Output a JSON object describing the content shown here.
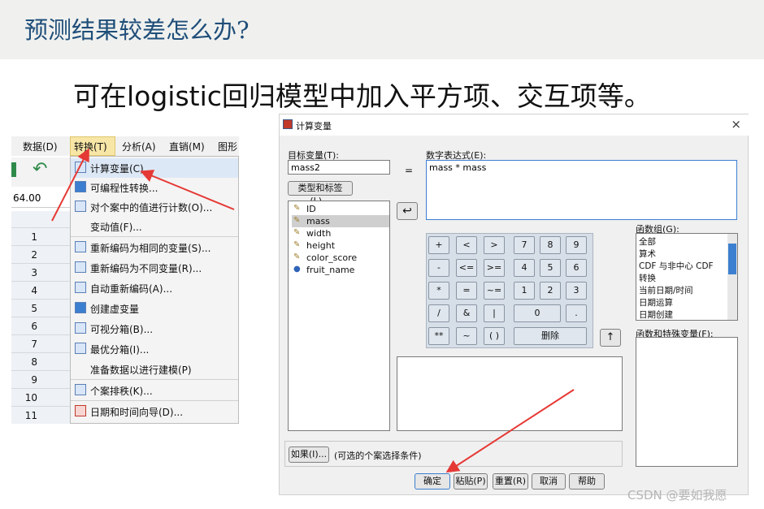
{
  "slide": {
    "title": "预测结果较差怎么办?",
    "subtitle": "可在logistic回归模型中加入平方项、交互项等。",
    "watermark": "CSDN @要如我愿"
  },
  "spss": {
    "menu_top": [
      "数据(D)",
      "转换(T)",
      "分析(A)",
      "直销(M)",
      "图形"
    ],
    "cell_value": "64.00",
    "row_numbers": [
      "1",
      "2",
      "3",
      "4",
      "5",
      "6",
      "7",
      "8",
      "9",
      "10",
      "11"
    ],
    "transform_menu": [
      {
        "label": "计算变量(C)...",
        "icon": "calculator-icon"
      },
      {
        "label": "可编程性转换...",
        "icon": "plus-icon"
      },
      {
        "label": "对个案中的值进行计数(O)...",
        "icon": "count-icon"
      },
      {
        "label": "变动值(F)...",
        "icon": ""
      },
      {
        "label": "重新编码为相同的变量(S)...",
        "icon": "recode-same-icon"
      },
      {
        "label": "重新编码为不同变量(R)...",
        "icon": "recode-different-icon"
      },
      {
        "label": "自动重新编码(A)...",
        "icon": "auto-recode-icon"
      },
      {
        "label": "创建虚变量",
        "icon": "plus-icon"
      },
      {
        "label": "可视分箱(B)...",
        "icon": "binning-icon"
      },
      {
        "label": "最优分箱(I)...",
        "icon": "optimal-binning-icon"
      },
      {
        "label": "准备数据以进行建模(P)",
        "icon": ""
      },
      {
        "label": "个案排秩(K)...",
        "icon": "rank-icon"
      },
      {
        "label": "日期和时间向导(D)...",
        "icon": "calendar-icon"
      }
    ]
  },
  "dialog": {
    "title": "计算变量",
    "target_label": "目标变量(T):",
    "target_value": "mass2",
    "equals": "=",
    "expr_label": "数字表达式(E):",
    "expr_value": "mass * mass",
    "type_label_button": "类型和标签(L)...",
    "variables": [
      {
        "name": "ID",
        "icon": "ruler-icon"
      },
      {
        "name": "mass",
        "icon": "ruler-icon",
        "selected": true
      },
      {
        "name": "width",
        "icon": "ruler-icon"
      },
      {
        "name": "height",
        "icon": "ruler-icon"
      },
      {
        "name": "color_score",
        "icon": "ruler-icon"
      },
      {
        "name": "fruit_name",
        "icon": "nominal-icon"
      }
    ],
    "keypad": {
      "row1": [
        "+",
        "<",
        ">",
        "7",
        "8",
        "9"
      ],
      "row2": [
        "-",
        "<=",
        ">=",
        "4",
        "5",
        "6"
      ],
      "row3": [
        "*",
        "=",
        "~=",
        "1",
        "2",
        "3"
      ],
      "row4": [
        "/",
        "&",
        "|",
        "0",
        "."
      ],
      "row5": [
        "**",
        "~",
        "( )",
        "删除"
      ]
    },
    "func_group_label": "函数组(G):",
    "func_groups": [
      "全部",
      "算术",
      "CDF 与非中心 CDF",
      "转换",
      "当前日期/时间",
      "日期运算",
      "日期创建"
    ],
    "func_vars_label": "函数和特殊变量(F):",
    "if_button": "如果(I)...",
    "if_text": "(可选的个案选择条件)",
    "buttons": [
      "确定",
      "粘贴(P)",
      "重置(R)",
      "取消",
      "帮助"
    ],
    "close": "×"
  },
  "colors": {
    "title": "#1f4e79",
    "arrow": "#e53935",
    "highlight": "#f7e6a6"
  }
}
